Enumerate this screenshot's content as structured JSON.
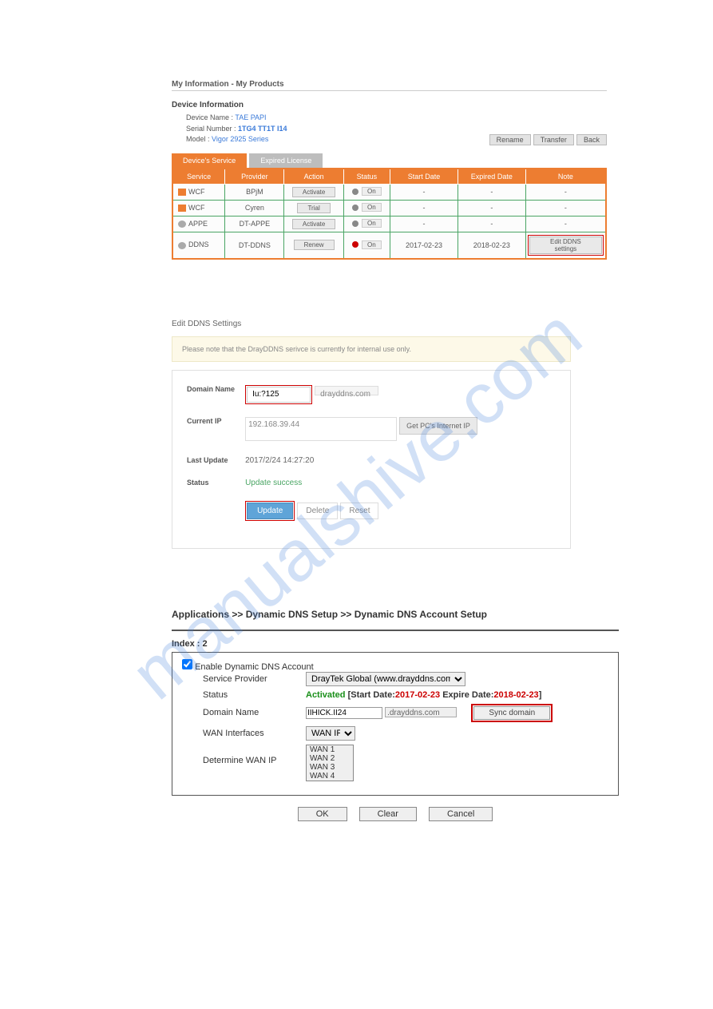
{
  "watermark": "manualshive.com",
  "sec1": {
    "breadcrumb": "My Information - My Products",
    "device_info_title": "Device Information",
    "device_name_label": "Device Name :",
    "device_name_value": "TAE PAPI",
    "serial_label": "Serial Number :",
    "serial_value": "1TG4 TT1T I14",
    "model_label": "Model :",
    "model_value": "Vigor 2925 Series",
    "btn_rename": "Rename",
    "btn_transfer": "Transfer",
    "btn_back": "Back",
    "tab_active": "Device's Service",
    "tab_inactive": "Expired License",
    "headers": {
      "service": "Service",
      "provider": "Provider",
      "action": "Action",
      "status": "Status",
      "start": "Start Date",
      "expired": "Expired Date",
      "note": "Note"
    },
    "rows": [
      {
        "service": "WCF",
        "provider": "BPjM",
        "action": "Activate",
        "on": "On",
        "dot": "g",
        "start": "-",
        "exp": "-",
        "note": "-"
      },
      {
        "service": "WCF",
        "provider": "Cyren",
        "action": "Trial",
        "on": "On",
        "dot": "g",
        "start": "-",
        "exp": "-",
        "note": "-"
      },
      {
        "service": "APPE",
        "provider": "DT-APPE",
        "action": "Activate",
        "on": "On",
        "dot": "g",
        "start": "-",
        "exp": "-",
        "note": "-"
      },
      {
        "service": "DDNS",
        "provider": "DT-DDNS",
        "action": "Renew",
        "on": "On",
        "dot": "r",
        "start": "2017-02-23",
        "exp": "2018-02-23",
        "note_btn": "Edit DDNS settings"
      }
    ]
  },
  "sec2": {
    "title": "Edit DDNS Settings",
    "note": "Please note that the DrayDDNS serivce is currently for internal use only.",
    "domain_label": "Domain Name",
    "domain_value": "Iu:?125",
    "domain_suffix": "drayddns.com",
    "ip_label": "Current IP",
    "ip_value": "192.168.39.44",
    "get_ip_btn": "Get PC's Internet IP",
    "last_update_label": "Last Update",
    "last_update_value": "2017/2/24 14:27:20",
    "status_label": "Status",
    "status_value": "Update success",
    "btn_update": "Update",
    "btn_delete": "Delete",
    "btn_reset": "Reset"
  },
  "sec3": {
    "breadcrumb": "Applications >> Dynamic DNS Setup >> Dynamic DNS Account Setup",
    "index": "Index : 2",
    "enable_label": "Enable Dynamic DNS Account",
    "sp_label": "Service Provider",
    "sp_value": "DrayTek Global (www.drayddns.com)",
    "status_label": "Status",
    "status_activated": "Activated",
    "status_open": " [Start Date:",
    "status_start": "2017-02-23",
    "status_mid": " Expire Date:",
    "status_exp": "2018-02-23",
    "status_close": "]",
    "dn_label": "Domain Name",
    "dn_value": "IIHICK.II24",
    "dn_suffix": ".drayddns.com",
    "sync_btn": "Sync domain",
    "wan_if_label": "WAN Interfaces",
    "wan_if_value": "WAN IP",
    "det_label": "Determine WAN IP",
    "wan_list": [
      "WAN 1",
      "WAN 2",
      "WAN 3",
      "WAN 4"
    ],
    "btn_ok": "OK",
    "btn_clear": "Clear",
    "btn_cancel": "Cancel"
  }
}
